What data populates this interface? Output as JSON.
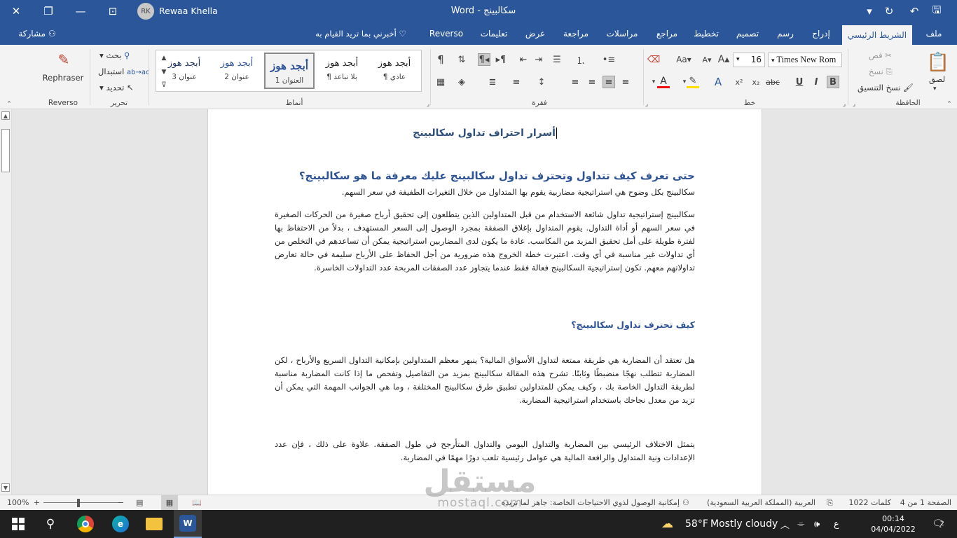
{
  "titlebar": {
    "title": "Word  -  سكالبينج",
    "user_initials": "RK",
    "user_name": "Rewaa Khella"
  },
  "tabs": {
    "file": "ملف",
    "home": "الشريط الرئيسي",
    "insert": "إدراج",
    "draw": "رسم",
    "design": "تصميم",
    "layout": "تخطيط",
    "references": "مراجع",
    "mailings": "مراسلات",
    "review": "مراجعة",
    "view": "عرض",
    "help": "تعليمات",
    "reverso": "Reverso",
    "tell_me": "أخبرني بما تريد القيام به",
    "share": "مشاركة"
  },
  "ribbon": {
    "clipboard": {
      "label": "الحافظة",
      "paste": "لصق",
      "cut": "قص",
      "copy": "نسخ",
      "format_painter": "نسخ التنسيق"
    },
    "font": {
      "label": "خط",
      "name": "Times New Rom",
      "size": "16"
    },
    "paragraph": {
      "label": "فقرة"
    },
    "styles": {
      "label": "أنماط",
      "sample": "أبجد هوز",
      "items": [
        "¶ عادي",
        "¶ بلا تباعد",
        "العنوان 1",
        "عنوان 2",
        "عنوان 3"
      ]
    },
    "editing": {
      "label": "تحرير",
      "find": "بحث",
      "replace": "استبدال",
      "select": "تحديد"
    },
    "reverso": {
      "label": "Reverso",
      "rephraser": "Rephraser"
    }
  },
  "document": {
    "title": "أسرار احتراف تداول سكالبينج",
    "heading1": "حتى تعرف كيف تتداول وتحترف تداول سكالبينج عليك معرفة ما هو سكالبينج؟",
    "intro": "سكالبينج بكل وضوح هي استراتيجية مضاربية يقوم بها المتداول من خلال التغيرات الطفيفة في سعر السهم.",
    "para1": "سكالبينج  إستراتيجية تداول شائعة الاستخدام من قبل المتداولين الذين يتطلعون إلى تحقيق أرباح صغيرة من الحركات الصغيرة في سعر السهم أو أداة التداول. يقوم المتداول بإغلاق الصفقة بمجرد الوصول إلى السعر المستهدف ، بدلاً من الاحتفاظ بها لفترة طويلة على أمل تحقيق المزيد من المكاسب. عادة ما يكون لدى المضاربين استراتيجية يمكن أن تساعدهم في التخلص من أي تداولات غير مناسبة في أي وقت. اعتبرت خطة الخروج هذه ضرورية من أجل الحفاظ على الأرباح سليمة في حالة تعارض تداولاتهم معهم. تكون إستراتيجية السكالبينج فعالة فقط عندما يتجاوز عدد الصفقات المربحة عدد التداولات الخاسرة.",
    "heading2": "كيف تحترف تداول سكالبينج؟",
    "para2": "هل تعتقد أن المضاربة هي طريقة ممتعة لتداول الأسواق المالية؟ ينبهر معظم المتداولين بإمكانية التداول السريع والأرباح ، لكن المضاربة تتطلب نهجًا منضبطًا وثابتًا. تشرح هذه المقالة سكالبينج بمزيد من التفاصيل وتفحص ما إذا كانت المضاربة مناسبة لطريقة التداول الخاصة بك ، وكيف يمكن للمتداولين تطبيق طرق سكالبينج المختلفة ، وما هي الجوانب المهمة التي يمكن أن تزيد من معدل نجاحك باستخدام استراتيجية المضاربة.",
    "para3": "يتمثل الاختلاف الرئيسي بين المضاربة والتداول اليومي والتداول المتأرجح في طول الصفقة. علاوة على ذلك ، فإن عدد الإعدادات ونية المتداول والرافعة المالية هي عوامل رئيسية تلعب دورًا مهمًا في المضاربة."
  },
  "statusbar": {
    "page": "الصفحة 1 من 4",
    "words": "1022 كلمات",
    "language": "العربية (المملكة العربية السعودية)",
    "accessibility": "إمكانية الوصول لذوي الاحتياجات الخاصة: جاهز لما تريده",
    "zoom": "100%"
  },
  "watermark": {
    "arabic": "مستقل",
    "latin": "mostaql.com"
  },
  "taskbar": {
    "weather_temp": "58°F",
    "weather_text": "Mostly cloudy",
    "lang": "ع",
    "time": "00:14",
    "date": "04/04/2022",
    "notifications": "2"
  },
  "colors": {
    "accent": "#2b579a",
    "heading": "#2f5496",
    "taskbar": "#202020"
  }
}
